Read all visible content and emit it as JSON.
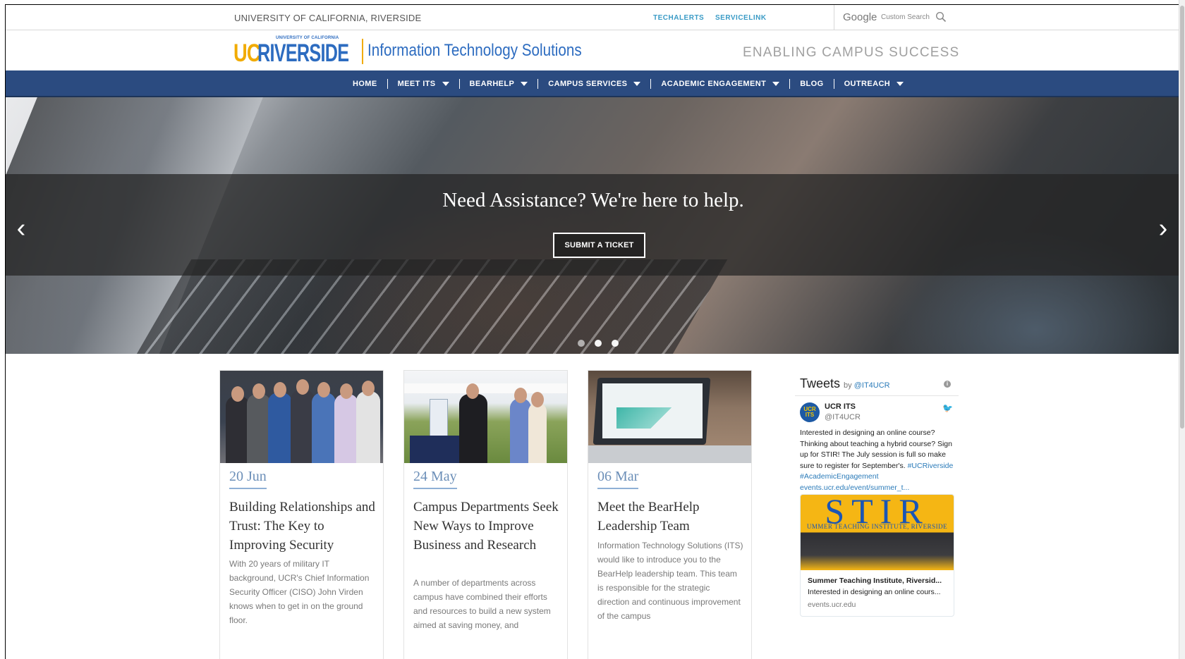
{
  "utility": {
    "university": "UNIVERSITY OF CALIFORNIA, RIVERSIDE",
    "links": [
      "TECHALERTS",
      "SERVICELINK"
    ],
    "search_brand": "Google",
    "search_placeholder": "Custom Search"
  },
  "brand": {
    "logo_uc": "UC",
    "logo_riverside": "RIVERSIDE",
    "logo_uoc": "UNIVERSITY OF CALIFORNIA",
    "dept_name": "Information Technology Solutions",
    "tagline": "ENABLING CAMPUS SUCCESS"
  },
  "nav": {
    "items": [
      {
        "label": "HOME",
        "dropdown": false
      },
      {
        "label": "MEET ITS",
        "dropdown": true
      },
      {
        "label": "BEARHELP",
        "dropdown": true
      },
      {
        "label": "CAMPUS SERVICES",
        "dropdown": true
      },
      {
        "label": "ACADEMIC ENGAGEMENT",
        "dropdown": true
      },
      {
        "label": "BLOG",
        "dropdown": false
      },
      {
        "label": "OUTREACH",
        "dropdown": true
      }
    ]
  },
  "hero": {
    "headline": "Need Assistance? We're here to help.",
    "cta": "SUBMIT A TICKET",
    "prev_arrow": "‹",
    "next_arrow": "›",
    "slide_count": 3
  },
  "cards": [
    {
      "date": "20 Jun",
      "title": "Building Relationships and Trust: The Key to Improving Security",
      "body": "With 20 years of military IT background, UCR's Chief Information Security Officer (CISO) John Virden knows when to get in on the ground floor."
    },
    {
      "date": "24 May",
      "title": "Campus Departments Seek New Ways to Improve Business and Research",
      "body": "A number of departments across campus have combined their efforts and resources to build a new system aimed at saving money, and"
    },
    {
      "date": "06 Mar",
      "title": "Meet the BearHelp Leadership Team",
      "body": "Information Technology Solutions (ITS) would like to introduce you to the BearHelp leadership team. This team is responsible for the strategic direction and continuous improvement of the campus"
    }
  ],
  "tweets": {
    "title": "Tweets",
    "by": "by",
    "account_link": "@IT4UCR",
    "tweet": {
      "avatar": "UCR ITS",
      "name": "UCR ITS",
      "handle": "@IT4UCR",
      "text": "Interested in designing an online course? Thinking about teaching a hybrid course? Sign up for STIR! The July session is full so make sure to register for September's.",
      "hashtag1": "#UCRiverside",
      "hashtag2": "#AcademicEngagement",
      "link": "events.ucr.edu/event/summer_t...",
      "card_logo": "STIR",
      "card_logo_sub": "UMMER TEACHING INSTITUTE, RIVERSIDE",
      "card_title": "Summer Teaching Institute, Riversid...",
      "card_desc": "Interested in designing an online cours...",
      "card_url": "events.ucr.edu"
    }
  },
  "colors": {
    "nav_bg": "#2b4b80",
    "link_blue": "#3a9bc6",
    "ucr_gold": "#f1ab00",
    "ucr_blue": "#2d6cc0",
    "date_blue": "#6c8fb8"
  }
}
